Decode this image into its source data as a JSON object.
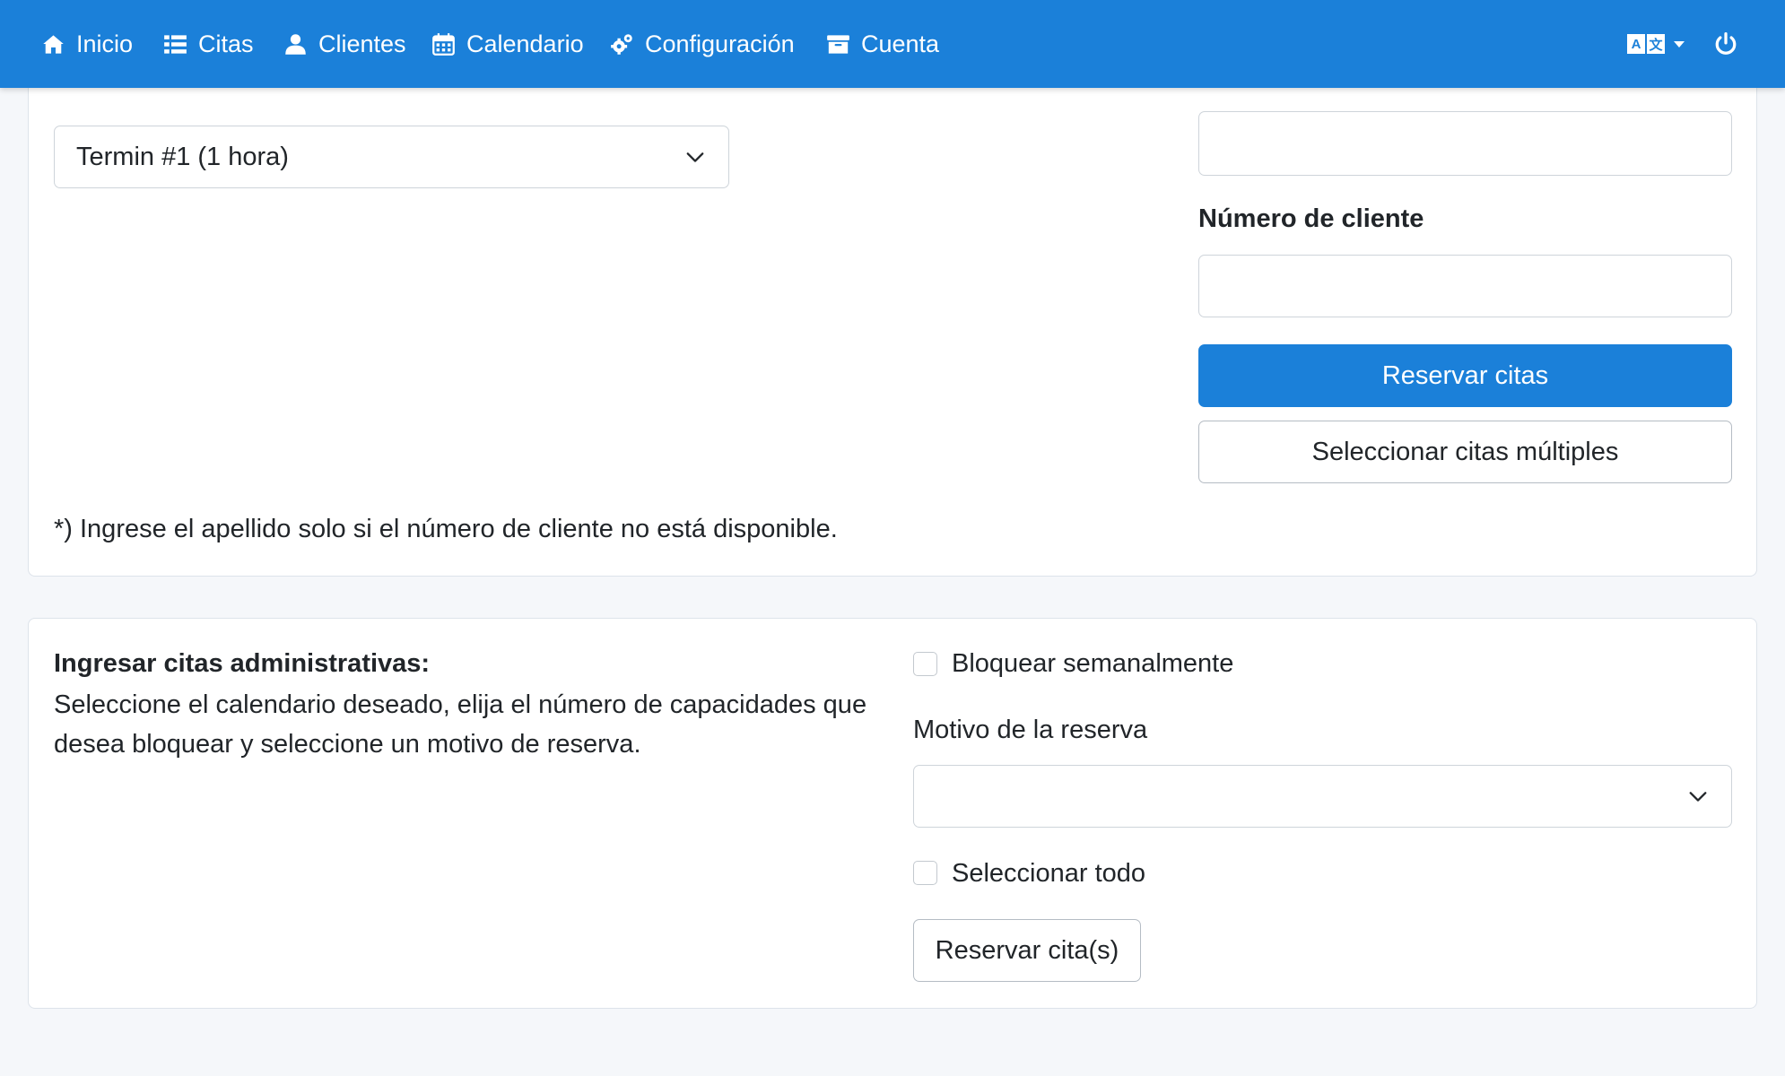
{
  "nav": {
    "items": [
      {
        "label": "Inicio",
        "icon": "home-icon"
      },
      {
        "label": "Citas",
        "icon": "list-icon"
      },
      {
        "label": "Clientes",
        "icon": "user-icon"
      },
      {
        "label": "Calendario",
        "icon": "calendar-icon"
      },
      {
        "label": "Configuración",
        "icon": "cogs-icon"
      },
      {
        "label": "Cuenta",
        "icon": "archive-icon"
      }
    ],
    "language_icon": "language-icon",
    "power_icon": "power-icon"
  },
  "colors": {
    "primary": "#1b80d9",
    "background": "#f5f7fa",
    "text": "#212529"
  },
  "booking_card": {
    "appointment_select_value": "Termin #1 (1 hora)",
    "top_field_value": "",
    "customer_number_label": "Número de cliente",
    "customer_number_value": "",
    "reserve_button": "Reservar citas",
    "multi_select_button": "Seleccionar citas múltiples",
    "footnote": "*) Ingrese el apellido solo si el número de cliente no está disponible."
  },
  "admin_card": {
    "title": "Ingresar citas administrativas:",
    "description": "Seleccione el calendario deseado, elija el número de capacidades que desea bloquear y seleccione un motivo de reserva.",
    "block_weekly_label": "Bloquear semanalmente",
    "block_weekly_checked": false,
    "reason_label": "Motivo de la reserva",
    "reason_value": "",
    "select_all_label": "Seleccionar todo",
    "select_all_checked": false,
    "reserve_button": "Reservar cita(s)"
  }
}
